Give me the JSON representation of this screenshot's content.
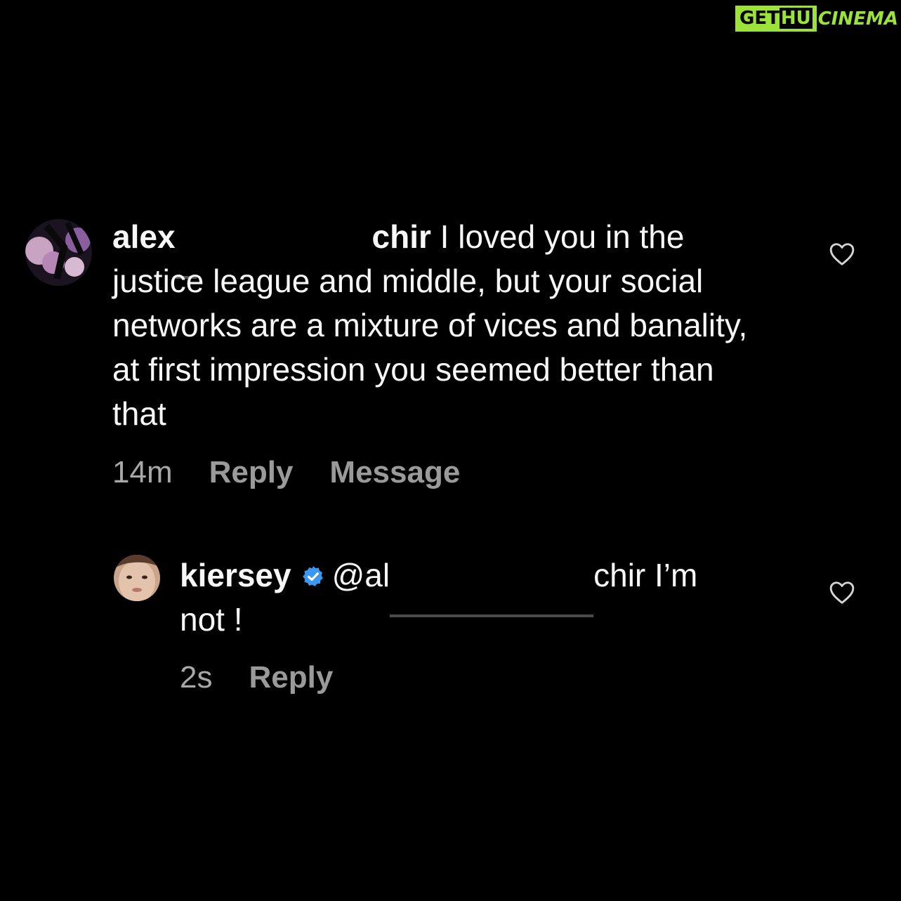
{
  "watermark": {
    "part1": "GET",
    "part2": "HU",
    "part3": "CINEMA"
  },
  "comments": [
    {
      "username": "alex",
      "username_tail": "chir",
      "text": " I loved you in the justice league and middle, but your social networks are a mixture of vices and banality, at first impression you seemed better than that",
      "time": "14m",
      "actions": [
        "Reply",
        "Message"
      ],
      "liked": false
    },
    {
      "username": "kiersey",
      "verified": true,
      "mention_start": "@al",
      "mention_end": "chir",
      "text": " I’m not !",
      "time": "2s",
      "actions": [
        "Reply"
      ],
      "liked": false
    }
  ],
  "colors": {
    "background": "#000000",
    "text": "#f7f7f7",
    "meta": "#9a9a9a",
    "verified": "#3b97f0",
    "watermark": "#9be23a"
  },
  "icons": {
    "like": "heart-outline-icon",
    "verified": "verified-badge-icon"
  }
}
